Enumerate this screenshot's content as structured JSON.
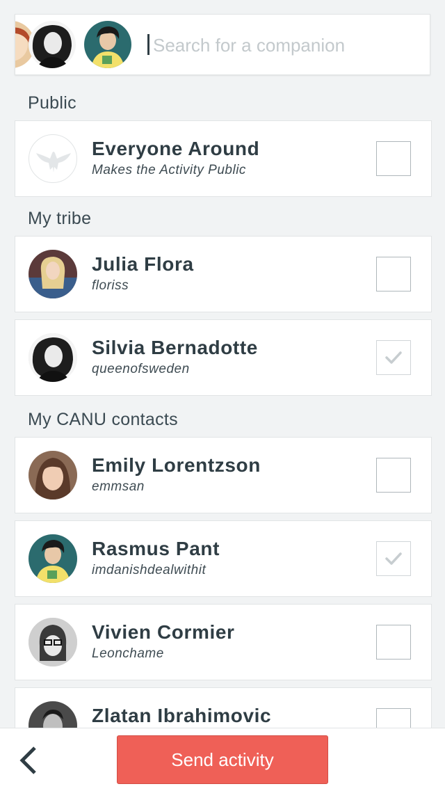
{
  "search": {
    "placeholder": "Search for a companion",
    "selected": [
      "silvia-bernadotte-avatar",
      "rasmus-pant-avatar"
    ]
  },
  "sections": {
    "public": "Public",
    "tribe": "My tribe",
    "contacts": "My CANU contacts"
  },
  "contacts": [
    {
      "name": "Everyone Around",
      "sub": "Makes the Activity Public",
      "checked": false,
      "icon": "eagle-icon"
    },
    {
      "name": "Julia Flora",
      "sub": "floriss",
      "checked": false
    },
    {
      "name": "Silvia Bernadotte",
      "sub": "queenofsweden",
      "checked": true
    },
    {
      "name": "Emily Lorentzson",
      "sub": "emmsan",
      "checked": false
    },
    {
      "name": "Rasmus Pant",
      "sub": "imdanishdealwithit",
      "checked": true
    },
    {
      "name": "Vivien Cormier",
      "sub": "Leonchame",
      "checked": false
    },
    {
      "name": "Zlatan Ibrahimovic",
      "sub": "",
      "checked": false
    }
  ],
  "footer": {
    "send_label": "Send activity",
    "back_icon": "chevron-left-icon"
  },
  "colors": {
    "accent": "#ef6057",
    "text": "#2f3d44",
    "background": "#f1f3f4",
    "check_mark": "#c7cdd0"
  }
}
